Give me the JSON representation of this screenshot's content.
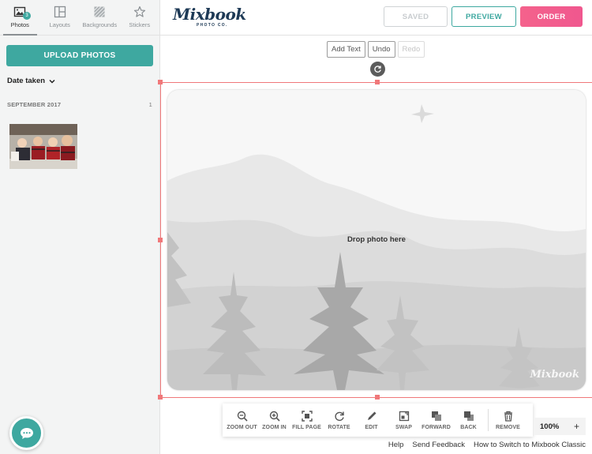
{
  "sidebar": {
    "tabs": [
      {
        "label": "Photos",
        "icon": "photo-icon",
        "active": true,
        "badge": "3"
      },
      {
        "label": "Layouts",
        "icon": "layout-icon"
      },
      {
        "label": "Backgrounds",
        "icon": "background-icon"
      },
      {
        "label": "Stickers",
        "icon": "star-icon"
      }
    ],
    "upload_label": "UPLOAD PHOTOS",
    "sort_label": "Date taken",
    "group": {
      "title": "SEPTEMBER 2017",
      "count": "1"
    }
  },
  "header": {
    "logo_text": "Mixbook",
    "logo_subtext": "PHOTO CO.",
    "saved_label": "SAVED",
    "preview_label": "PREVIEW",
    "order_label": "ORDER"
  },
  "canvas_tools": {
    "add_text": "Add Text",
    "undo": "Undo",
    "redo": "Redo"
  },
  "page": {
    "drop_label": "Drop photo here",
    "watermark": "Mixbook"
  },
  "toolbar": {
    "items": [
      {
        "label": "ZOOM OUT",
        "icon": "zoom-out-icon"
      },
      {
        "label": "ZOOM IN",
        "icon": "zoom-in-icon"
      },
      {
        "label": "FILL PAGE",
        "icon": "fill-page-icon"
      },
      {
        "label": "ROTATE",
        "icon": "rotate-icon"
      },
      {
        "label": "EDIT",
        "icon": "pencil-icon"
      },
      {
        "label": "SWAP",
        "icon": "swap-icon"
      },
      {
        "label": "FORWARD",
        "icon": "bring-forward-icon"
      },
      {
        "label": "BACK",
        "icon": "send-back-icon"
      },
      {
        "label": "REMOVE",
        "icon": "trash-icon"
      }
    ]
  },
  "zoom": {
    "value": "100%",
    "plus": "+"
  },
  "footer": {
    "help": "Help",
    "feedback": "Send Feedback",
    "switch": "How to Switch to Mixbook Classic"
  },
  "colors": {
    "accent": "#3ea8a0",
    "order": "#f0578e",
    "selection": "#f0787a",
    "brand": "#1e3a56"
  }
}
